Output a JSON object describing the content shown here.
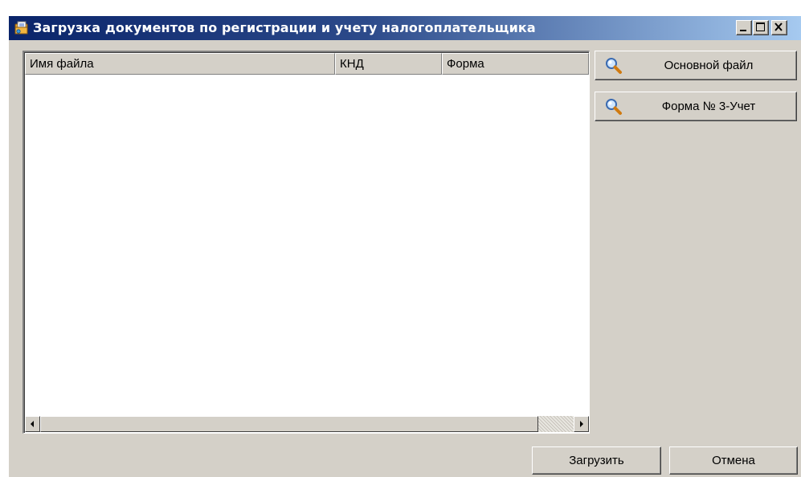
{
  "window": {
    "title": "Загрузка документов по регистрации и учету налогоплательщика",
    "icon": "document-folder-icon",
    "controls": {
      "minimize": "minimize-icon",
      "maximize": "maximize-icon",
      "close": "close-icon"
    }
  },
  "list": {
    "columns": [
      "Имя файла",
      "КНД",
      "Форма"
    ],
    "rows": []
  },
  "side_buttons": {
    "main_file_label": "Основной файл",
    "form_label": "Форма № 3-Учет",
    "icon": "magnifier-icon"
  },
  "footer": {
    "load_label": "Загрузить",
    "cancel_label": "Отмена"
  },
  "colors": {
    "title_start": "#0a246a",
    "title_end": "#a6caf0",
    "face": "#d4d0c8"
  }
}
